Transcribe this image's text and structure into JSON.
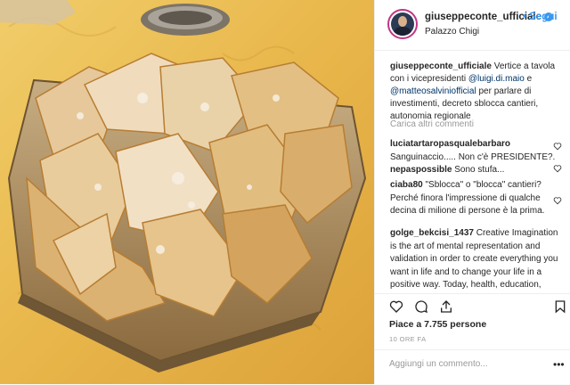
{
  "post": {
    "username": "giuseppeconte_ufficiale",
    "follow_label": "Segui",
    "location": "Palazzo Chigi",
    "caption": {
      "author": "giuseppeconte_ufficiale",
      "text_1": " Vertice a tavola con i vicepresidenti ",
      "mention_1": "@luigi.di.maio",
      "text_2": " e ",
      "mention_2": "@matteosalviniofficial",
      "text_3": " per parlare di investimenti, decreto sblocca cantieri, autonomia regionale"
    },
    "load_more": "Carica altri commenti",
    "comments": [
      {
        "user": "luciatartaropasqualebarbaro",
        "text": " Sanguinaccio..... Non c'è PRESIDENTE?."
      },
      {
        "user": "nepaspossible",
        "text": " Sono stufa..."
      },
      {
        "user": "ciaba80",
        "text": " \"Sblocca\" o \"blocca\" cantieri? Perché finora l'impressione di qualche decina di milione di persone è la prima."
      },
      {
        "user": "golge_bekcisi_1437",
        "text": " Creative Imagination is the art of mental representation and validation in order to create everything you want in life and to change your life in a positive way. Today, health, education, work"
      }
    ],
    "likes": "Piace a 7.755 persone",
    "time": "10 ORE FA",
    "add_comment_placeholder": "Aggiungi un commento...",
    "options_glyph": "•••"
  },
  "icons": {
    "verified": "verified-badge-icon",
    "like": "heart-icon",
    "comment": "comment-bubble-icon",
    "share": "share-icon",
    "save": "bookmark-icon"
  },
  "colors": {
    "link": "#3897f0",
    "mention": "#003569",
    "muted": "#999999",
    "border": "#efefef",
    "tablecloth": "#e9b94f"
  }
}
